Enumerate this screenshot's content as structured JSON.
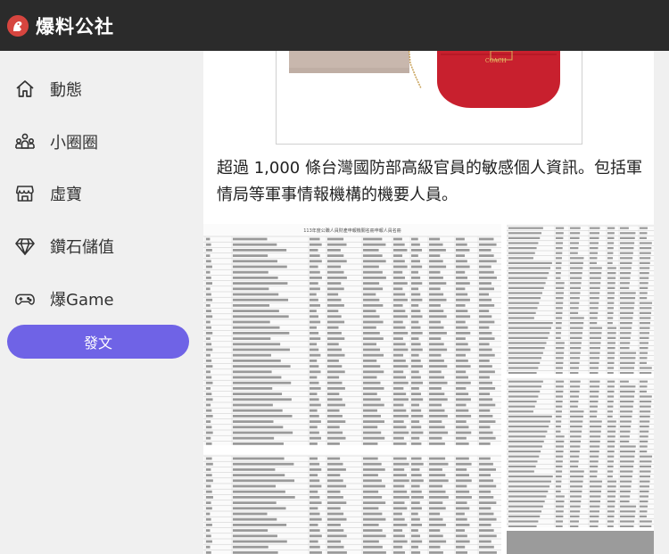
{
  "app": {
    "name": "爆料公社"
  },
  "sidebar": {
    "items": [
      {
        "label": "動態",
        "icon": "home-icon"
      },
      {
        "label": "小圈圈",
        "icon": "group-icon"
      },
      {
        "label": "虛寶",
        "icon": "store-icon"
      },
      {
        "label": "鑽石儲值",
        "icon": "diamond-icon"
      },
      {
        "label": "爆Game",
        "icon": "gamepad-icon"
      }
    ],
    "post_button": "發文"
  },
  "post": {
    "paragraph": "超過 1,000 條台灣國防部高級官員的敏感個人資訊。包括軍情局等軍事情報機構的機要人員。",
    "product_image": {
      "brand_text": "COACH",
      "bag_colors": [
        "#c8b7ad",
        "#c8202e"
      ]
    },
    "document_title": "113年度公職人員財產申報機關名冊申報人員名冊"
  },
  "colors": {
    "topbar": "#2b2b2b",
    "accent": "#6f63e6",
    "logo": "#d6453f"
  }
}
